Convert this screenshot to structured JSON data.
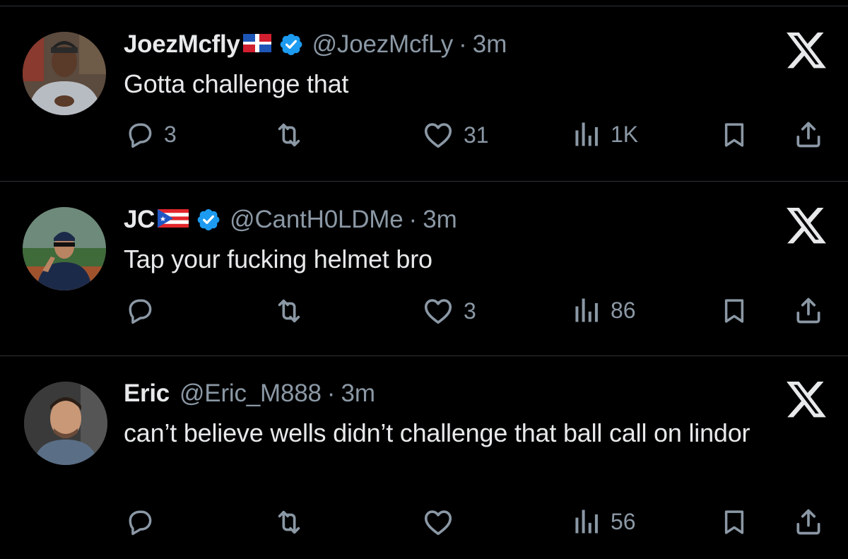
{
  "tweets": [
    {
      "name": "JoezMcfly",
      "handle": "@JoezMcfLy",
      "separator": "·",
      "time": "3m",
      "text": "Gotta challenge that",
      "flag": "dominican-republic-flag",
      "verified": true,
      "replies": "3",
      "retweets": "",
      "likes": "31",
      "views": "1K"
    },
    {
      "name": "JC",
      "handle": "@CantH0LDMe",
      "separator": "·",
      "time": "3m",
      "text": "Tap your fucking helmet bro",
      "flag": "puerto-rico-flag",
      "verified": true,
      "replies": "",
      "retweets": "",
      "likes": "3",
      "views": "86"
    },
    {
      "name": "Eric",
      "handle": "@Eric_M888",
      "separator": "·",
      "time": "3m",
      "text": "can’t believe wells didn’t challenge that ball call on lindor",
      "flag": "",
      "verified": false,
      "replies": "",
      "retweets": "",
      "likes": "",
      "views": "56"
    }
  ],
  "icons": {
    "reply": "reply-icon",
    "retweet": "retweet-icon",
    "like": "heart-icon",
    "views": "views-bar-chart-icon",
    "bookmark": "bookmark-icon",
    "share": "share-icon",
    "close": "x-logo-icon",
    "verified": "verified-badge-icon"
  },
  "colors": {
    "background": "#000000",
    "primary_text": "#e7e9ea",
    "secondary_text": "#8b98a5",
    "verified_blue": "#1d9bf0",
    "divider": "#2f3336"
  }
}
